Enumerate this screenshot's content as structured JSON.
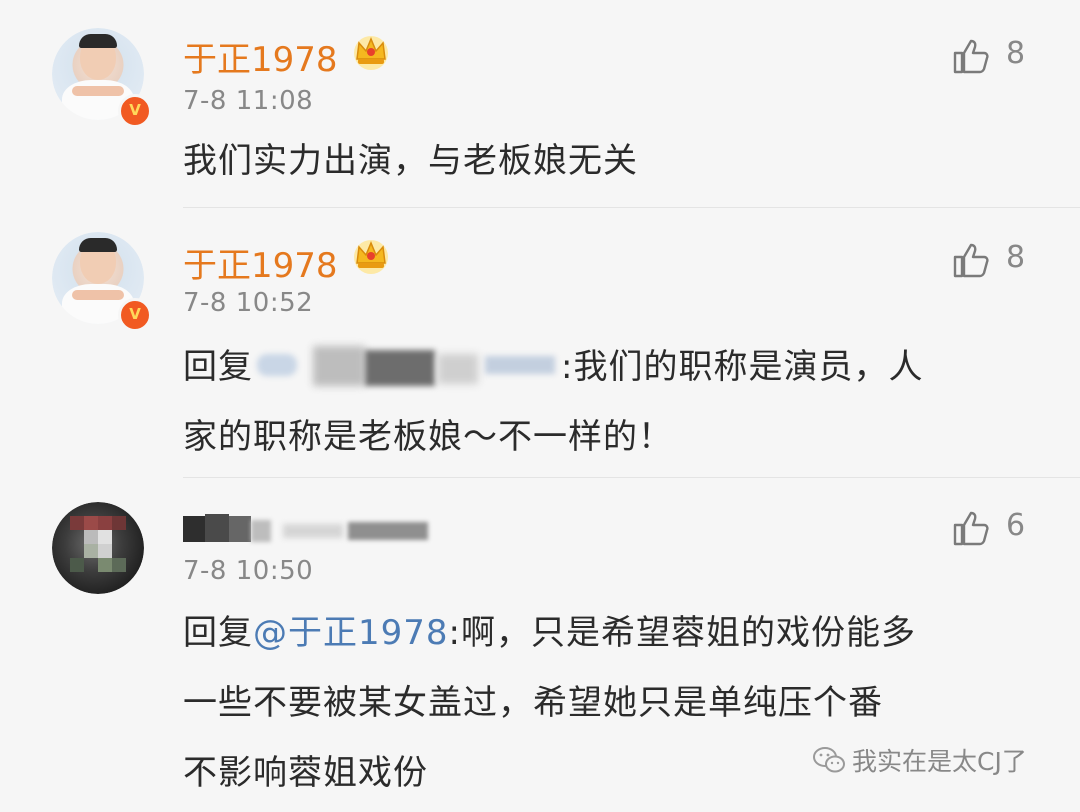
{
  "comments": [
    {
      "username": "于正1978",
      "time": "7-8 11:08",
      "like_count": "8",
      "text": "我们实力出演，与老板娘无关"
    },
    {
      "username": "于正1978",
      "time": "7-8 10:52",
      "like_count": "8",
      "reply_prefix": "回复",
      "text_line1": ":我们的职称是演员，人",
      "text_line2": "家的职称是老板娘～不一样的！"
    },
    {
      "username": "",
      "time": "7-8 10:50",
      "like_count": "6",
      "reply_prefix": "回复",
      "mention": "@于正1978",
      "text_line1": ":啊，只是希望蓉姐的戏份能多",
      "text_line2": "一些不要被某女盖过，希望她只是单纯压个番",
      "text_line3": "不影响蓉姐戏份"
    }
  ],
  "icons": {
    "like": "thumbs-up-icon",
    "verified": "verified-v-badge",
    "vip": "crown-icon"
  },
  "badge_letter": "V",
  "colors": {
    "username": "#e5791e",
    "mention": "#4c7bb4",
    "badge": "#f15a22",
    "crown": "#f5b81f"
  },
  "watermark": {
    "text": "我实在是太CJ了"
  }
}
